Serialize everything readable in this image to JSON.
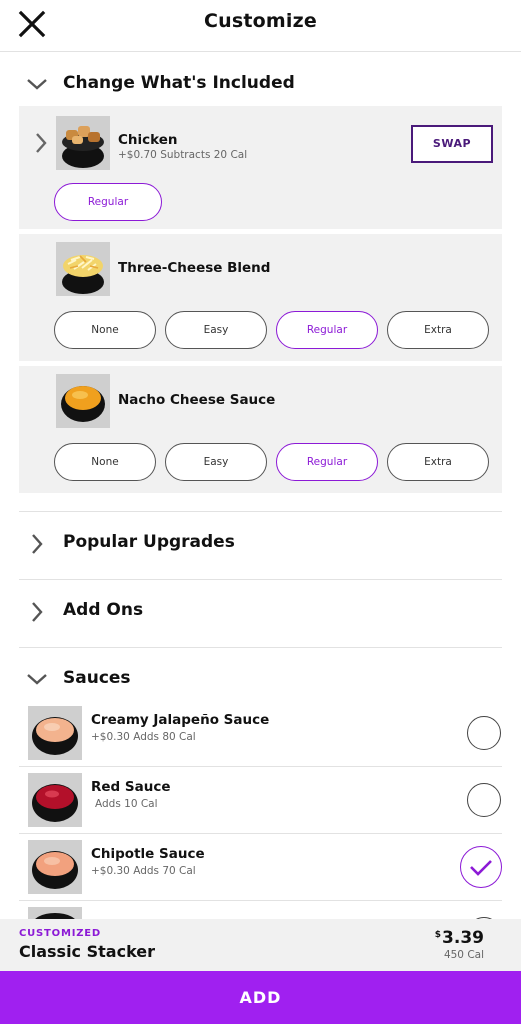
{
  "header": {
    "title": "Customize",
    "close_icon": "close-icon"
  },
  "sections": {
    "included": {
      "label": "Change What's Included",
      "expanded": true
    },
    "popular": {
      "label": "Popular Upgrades",
      "expanded": false
    },
    "addons": {
      "label": "Add Ons",
      "expanded": false
    },
    "sauces": {
      "label": "Sauces",
      "expanded": true
    }
  },
  "included_items": [
    {
      "name": "Chicken",
      "price": "+$0.70",
      "cal": "Subtracts 20 Cal",
      "swap_label": "SWAP",
      "selected_option": "Regular"
    },
    {
      "name": "Three-Cheese Blend",
      "options": [
        "None",
        "Easy",
        "Regular",
        "Extra"
      ],
      "selected": "Regular"
    },
    {
      "name": "Nacho Cheese Sauce",
      "options": [
        "None",
        "Easy",
        "Regular",
        "Extra"
      ],
      "selected": "Regular"
    }
  ],
  "sauces": [
    {
      "name": "Creamy Jalapeño Sauce",
      "price": "+$0.30",
      "cal": "Adds 80 Cal",
      "checked": false
    },
    {
      "name": "Red Sauce",
      "price": "",
      "cal": "Adds 10 Cal",
      "checked": false
    },
    {
      "name": "Chipotle Sauce",
      "price": "+$0.30",
      "cal": "Adds 70 Cal",
      "checked": true
    }
  ],
  "footer": {
    "tag": "CUSTOMIZED",
    "product": "Classic Stacker",
    "price_symbol": "$",
    "price": "3.39",
    "cal": "450 Cal"
  },
  "add_button": {
    "label": "ADD"
  },
  "colors": {
    "accent": "#a020f0",
    "selected": "#8c1ad6",
    "swap": "#4a1a7a",
    "card_bg": "#f1f1f1"
  }
}
